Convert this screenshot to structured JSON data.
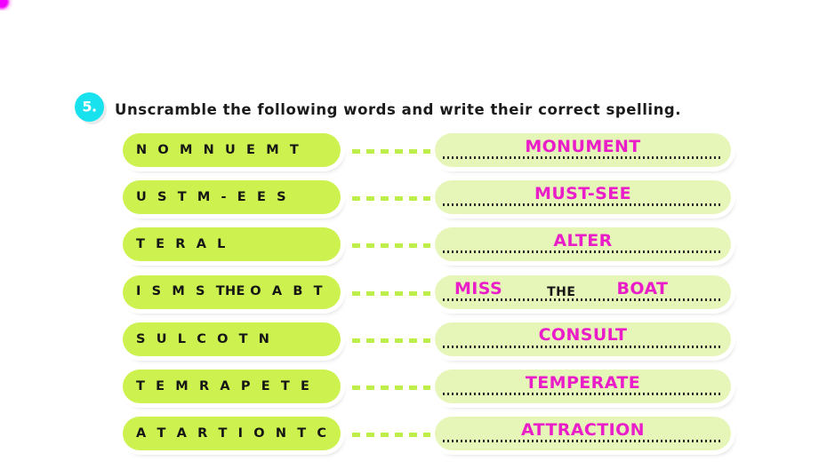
{
  "page": {
    "background_color": "#ffffff",
    "artifact_color": "#f200ff"
  },
  "exercise": {
    "number_label": "5.",
    "badge_color": "#18e2ee",
    "instruction": "Unscramble the following words and write their correct spelling."
  },
  "colors": {
    "scramble_pill": "#cdf24f",
    "answer_pill": "#e6f6b9",
    "answer_text": "#ea1ec9",
    "given_text": "#161616",
    "connector": "#bdee4a",
    "dotted_line": "#2b2b2b"
  },
  "rows": [
    {
      "scrambled": "N O M N U E M T",
      "answer": "MONUMENT",
      "multipart": false
    },
    {
      "scrambled": "U S T M - E E S",
      "answer": "MUST-SEE",
      "multipart": false
    },
    {
      "scrambled": "T E R A L",
      "answer": "ALTER",
      "multipart": false
    },
    {
      "scrambled_parts": [
        "I S M S",
        "THE",
        "O A B T"
      ],
      "scrambled": "I S M S THE O A B T",
      "multipart": true,
      "answer_parts": [
        {
          "text": "MISS",
          "kind": "filled"
        },
        {
          "text": "THE",
          "kind": "given"
        },
        {
          "text": "BOAT",
          "kind": "filled"
        }
      ],
      "answer": "MISS THE BOAT"
    },
    {
      "scrambled": "S U L C O T N",
      "answer": "CONSULT",
      "multipart": false
    },
    {
      "scrambled": "T E M R A P E T E",
      "answer": "TEMPERATE",
      "multipart": false
    },
    {
      "scrambled": "A T A R T I O N T C",
      "answer": "ATTRACTION",
      "multipart": false
    }
  ]
}
